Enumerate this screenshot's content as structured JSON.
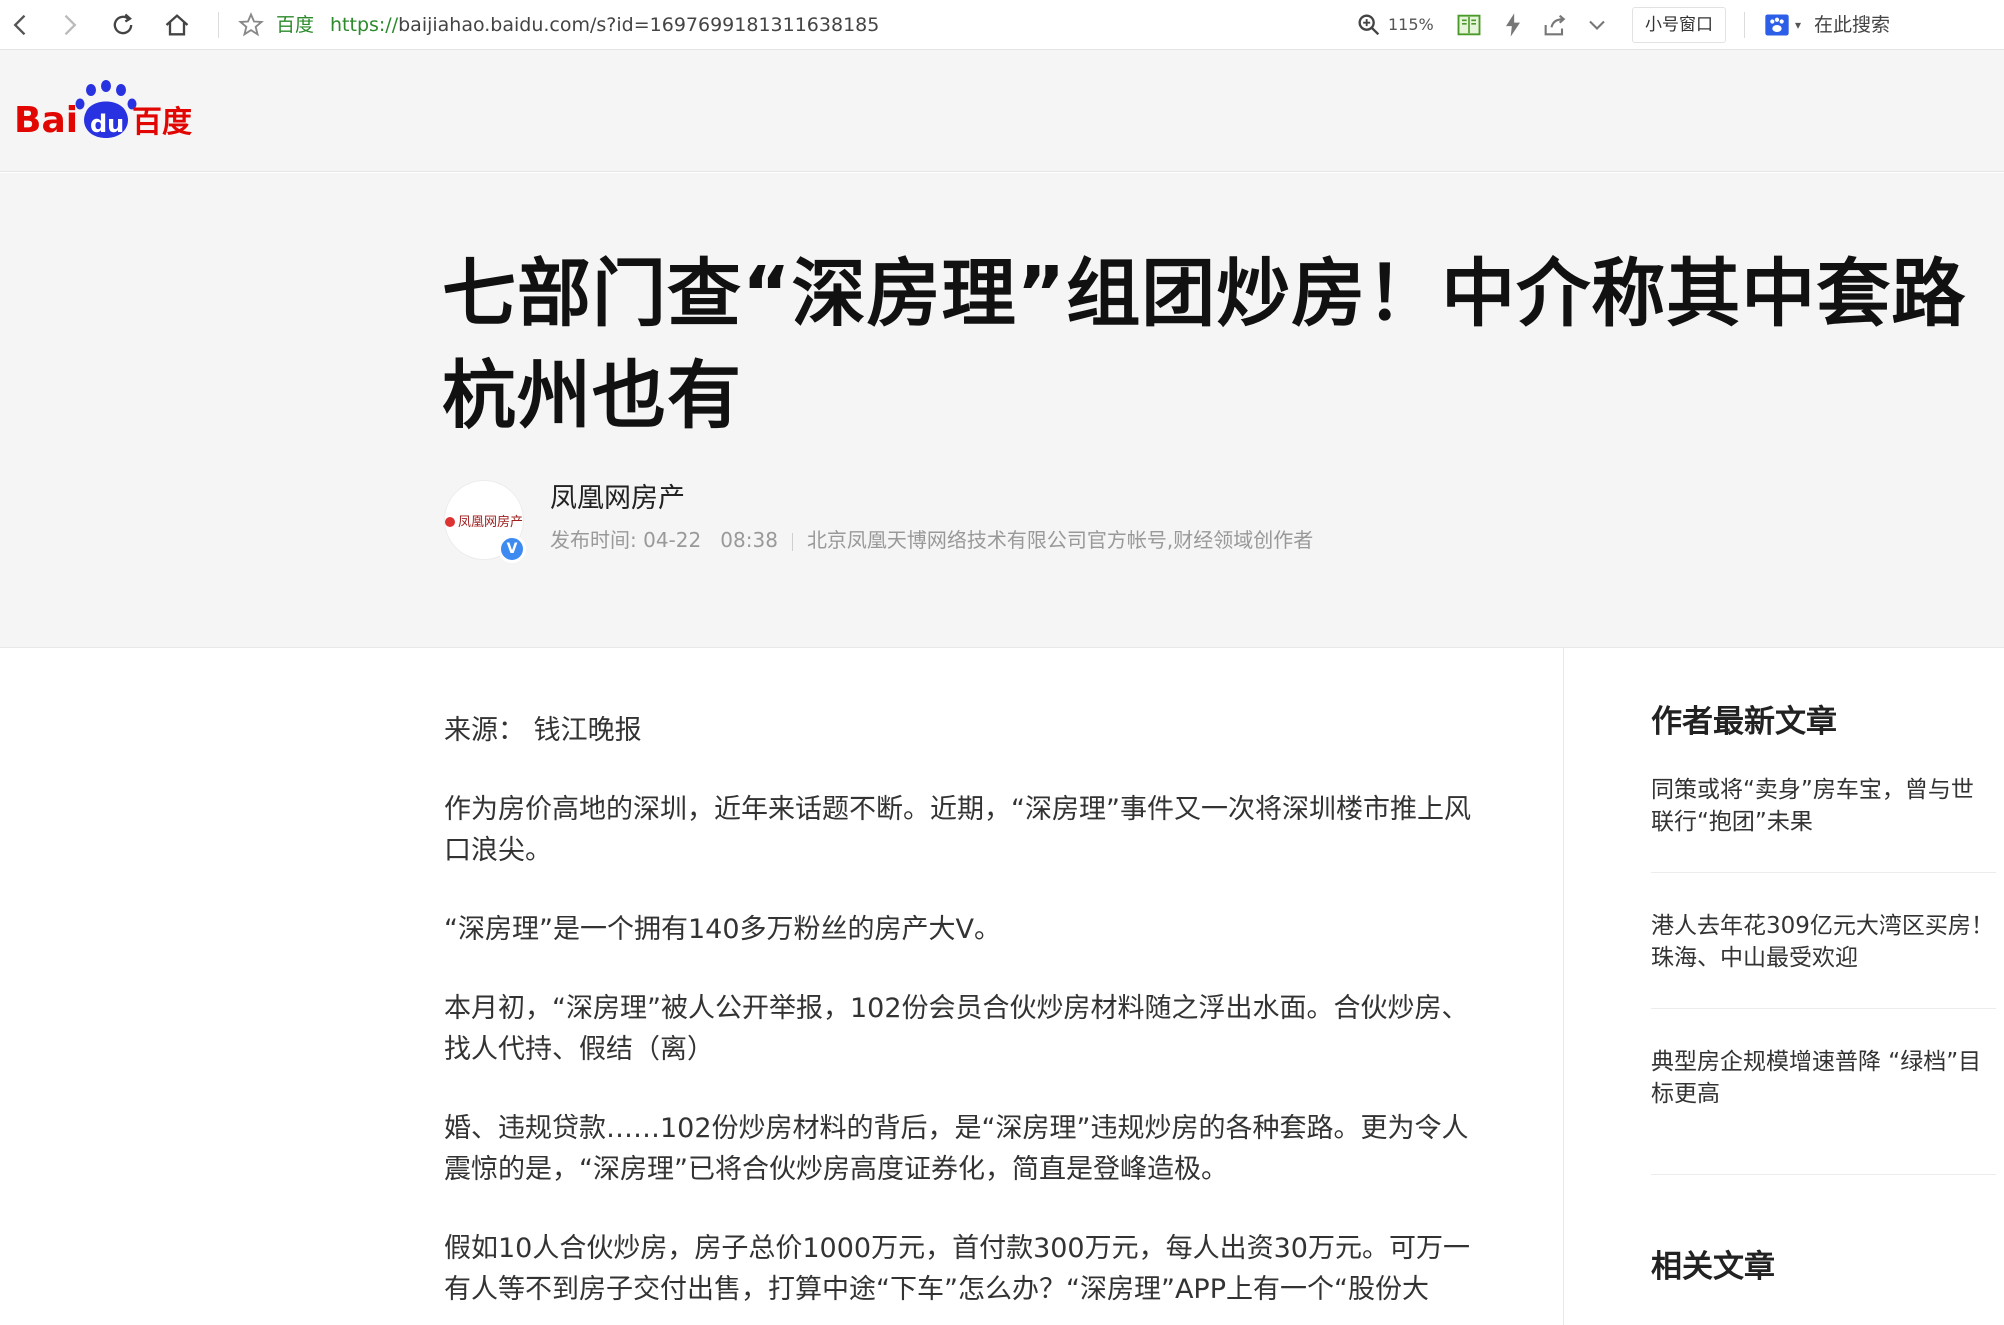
{
  "browser": {
    "site_label": "百度",
    "url_host": "https://",
    "url_path": "baijiahao.baidu.com/s?id=1697699181311638185",
    "zoom": "115%",
    "small_window": "小号窗口",
    "search_placeholder": "在此搜索"
  },
  "header": {
    "logo_text_left": "Bai",
    "logo_text_paw": "du",
    "logo_text_cn": "百度"
  },
  "article": {
    "title": "七部门查“深房理”组团炒房！中介称其中套路杭州也有",
    "author": "凤凰网房产",
    "avatar_label": "凤凰网房产",
    "publish_label": "发布时间: 04-22",
    "publish_time": "08:38",
    "author_desc": "北京凤凰天博网络技术有限公司官方帐号,财经领域创作者",
    "paragraphs": [
      "来源： 钱江晚报",
      "作为房价高地的深圳，近年来话题不断。近期，“深房理”事件又一次将深圳楼市推上风口浪尖。",
      "“深房理”是一个拥有140多万粉丝的房产大V。",
      "本月初，“深房理”被人公开举报，102份会员合伙炒房材料随之浮出水面。合伙炒房、找人代持、假结（离）",
      "婚、违规贷款……102份炒房材料的背后，是“深房理”违规炒房的各种套路。更为令人震惊的是，“深房理”已将合伙炒房高度证券化，简直是登峰造极。",
      "假如10人合伙炒房，房子总价1000万元，首付款300万元，每人出资30万元。可万一有人等不到房子交付出售，打算中途“下车”怎么办？“深房理”APP上有一个“股份大"
    ]
  },
  "sidebar": {
    "latest_heading": "作者最新文章",
    "latest": [
      "同策或将“卖身”房车宝，曾与世联行“抱团”未果",
      "港人去年花309亿元大湾区买房！珠海、中山最受欢迎",
      "典型房企规模增速普降 “绿档”目标更高"
    ],
    "related_heading": "相关文章"
  },
  "colors": {
    "baidu_red": "#e10602",
    "baidu_blue": "#2932e1",
    "url_green": "#2b8a2b"
  }
}
